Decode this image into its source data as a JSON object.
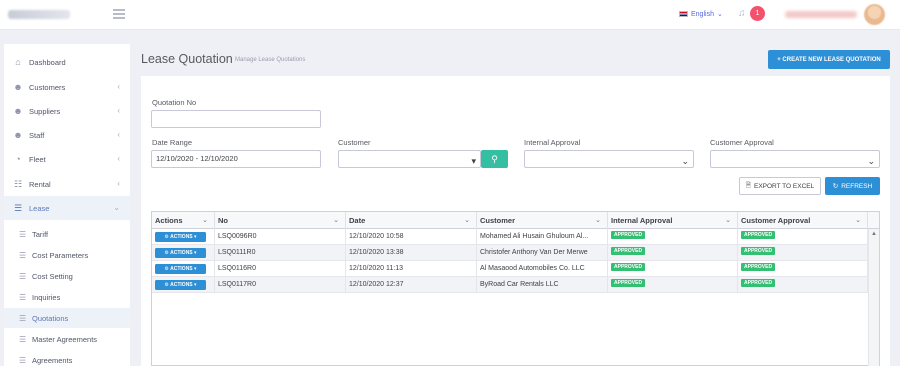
{
  "topbar": {
    "language": "English",
    "notifications_count": "1"
  },
  "sidebar": {
    "items": [
      {
        "label": "Dashboard",
        "icon": "home-icon",
        "has_chevron": false
      },
      {
        "label": "Customers",
        "icon": "users-icon",
        "has_chevron": true
      },
      {
        "label": "Suppliers",
        "icon": "users-icon",
        "has_chevron": true
      },
      {
        "label": "Staff",
        "icon": "users-icon",
        "has_chevron": true
      },
      {
        "label": "Fleet",
        "icon": "gauge-icon",
        "has_chevron": true
      },
      {
        "label": "Rental",
        "icon": "list-icon",
        "has_chevron": true
      },
      {
        "label": "Lease",
        "icon": "layers-icon",
        "has_chevron": true
      }
    ],
    "lease_sub": [
      "Tariff",
      "Cost Parameters",
      "Cost Setting",
      "Inquiries",
      "Quotations",
      "Master Agreements",
      "Agreements"
    ]
  },
  "header": {
    "title": "Lease Quotation",
    "subtitle": "Manage Lease Quotations",
    "create_button": "+ CREATE NEW LEASE QUOTATION"
  },
  "filters": {
    "quotation_no_label": "Quotation No",
    "quotation_no_value": "",
    "date_range_label": "Date Range",
    "date_range_value": "12/10/2020 - 12/10/2020",
    "customer_label": "Customer",
    "customer_value": "",
    "internal_approval_label": "Internal Approval",
    "internal_approval_value": "",
    "customer_approval_label": "Customer Approval",
    "customer_approval_value": ""
  },
  "toolbar": {
    "export_label": "EXPORT TO EXCEL",
    "refresh_label": "REFRESH"
  },
  "grid": {
    "columns": [
      "Actions",
      "No",
      "Date",
      "Customer",
      "Internal Approval",
      "Customer Approval"
    ],
    "action_label": "⚙ ACTIONS ▾",
    "rows": [
      {
        "no": "LSQ0096R0",
        "date": "12/10/2020 10:58",
        "customer": "Mohamed Ali Husain Ghuloum Al...",
        "internal": "APPROVED",
        "customer_approval": "APPROVED"
      },
      {
        "no": "LSQ0111R0",
        "date": "12/10/2020 13:38",
        "customer": "Christofer Anthony Van Der Merwe",
        "internal": "APPROVED",
        "customer_approval": "APPROVED"
      },
      {
        "no": "LSQ0116R0",
        "date": "12/10/2020 11:13",
        "customer": "Al Masaood Automobiles Co. LLC",
        "internal": "APPROVED",
        "customer_approval": "APPROVED"
      },
      {
        "no": "LSQ0117R0",
        "date": "12/10/2020 12:37",
        "customer": "ByRoad Car Rentals LLC",
        "internal": "APPROVED",
        "customer_approval": "APPROVED"
      }
    ]
  },
  "colors": {
    "primary": "#2d8fd5",
    "success": "#34bfa3",
    "approved": "#34bf73",
    "badge": "#f4516c"
  }
}
